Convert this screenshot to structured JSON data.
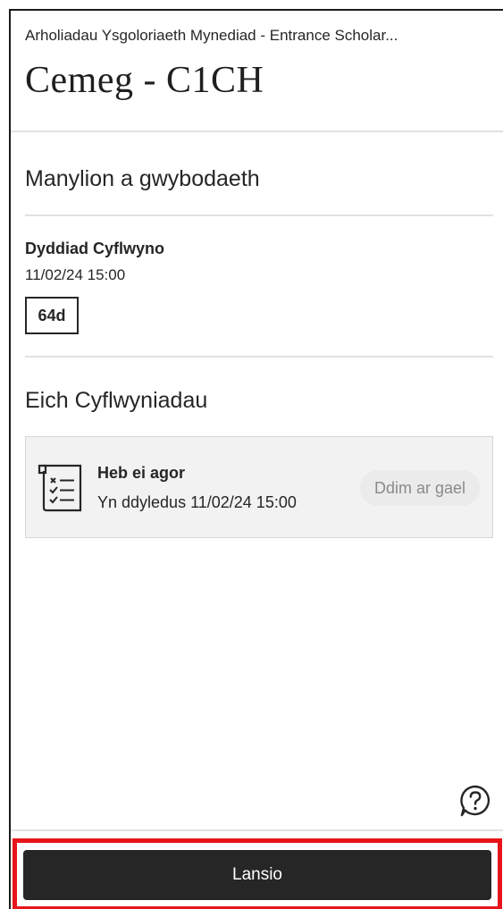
{
  "header": {
    "course_name": "Arholiadau Ysgoloriaeth Mynediad - Entrance Scholar...",
    "title": "Cemeg - C1CH"
  },
  "details": {
    "heading": "Manylion a gwybodaeth",
    "due_label": "Dyddiad Cyflwyno",
    "due_date": "11/02/24 15:00",
    "days_remaining": "64d"
  },
  "submissions": {
    "heading": "Eich Cyflwyniadau",
    "card": {
      "icon": "assessment-checklist-icon",
      "status": "Heb ei agor",
      "due": "Yn ddyledus 11/02/24 15:00",
      "availability": "Ddim ar gael"
    }
  },
  "help": {
    "icon": "help-question-icon"
  },
  "footer": {
    "launch_label": "Lansio",
    "highlight_color": "#e8141b"
  },
  "colors": {
    "text": "#262626",
    "button": "#262626",
    "card_bg": "#f2f2f2",
    "divider": "#e1e1e1"
  }
}
